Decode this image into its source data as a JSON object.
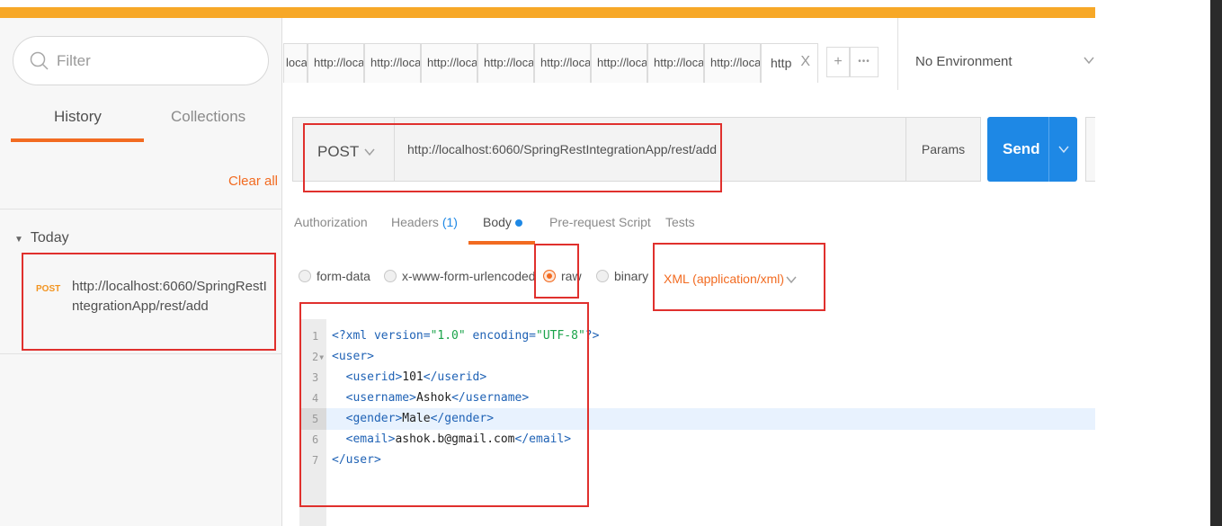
{
  "sidebar": {
    "filter_placeholder": "Filter",
    "tabs": {
      "history": "History",
      "collections": "Collections"
    },
    "clear_all": "Clear all",
    "group_label": "Today",
    "history_items": [
      {
        "method": "POST",
        "url": "http://localhost:6060/SpringRestIntegrationApp/rest/add"
      }
    ]
  },
  "tabs": {
    "items": [
      "loca",
      "http://loca",
      "http://loca",
      "http://loca",
      "http://loca",
      "http://loca",
      "http://loca",
      "http://loca",
      "http://loca"
    ],
    "active": "http",
    "close": "X",
    "add": "+",
    "more": "•••"
  },
  "environment": {
    "selected": "No Environment"
  },
  "request": {
    "method": "POST",
    "url": "http://localhost:6060/SpringRestIntegrationApp/rest/add",
    "params_label": "Params",
    "send_label": "Send"
  },
  "subtabs": {
    "authorization": "Authorization",
    "headers": "Headers",
    "headers_count": "(1)",
    "body": "Body",
    "prerequest": "Pre-request Script",
    "tests": "Tests"
  },
  "body_options": {
    "form_data": "form-data",
    "urlencoded": "x-www-form-urlencoded",
    "raw": "raw",
    "binary": "binary",
    "content_type": "XML (application/xml)",
    "selected": "raw"
  },
  "editor": {
    "line_numbers": [
      "1",
      "2",
      "3",
      "4",
      "5",
      "6",
      "7"
    ],
    "active_line": 5,
    "lines": {
      "l1": {
        "open": "<?xml version=",
        "v1": "\"1.0\"",
        "mid": " encoding=",
        "v2": "\"UTF-8\"",
        "close": "?>"
      },
      "l2": {
        "tag": "<user>"
      },
      "l3": {
        "open": "<userid>",
        "val": "101",
        "close": "</userid>"
      },
      "l4": {
        "open": "<username>",
        "val": "Ashok",
        "close": "</username>"
      },
      "l5": {
        "open": "<gender>",
        "val": "Male",
        "close": "</gender>"
      },
      "l6": {
        "open": "<email>",
        "val": "ashok.b@gmail.com",
        "close": "</email>"
      },
      "l7": {
        "tag": "</user>"
      }
    }
  },
  "colors": {
    "accent_orange": "#f26b21",
    "send_blue": "#1e88e5",
    "annotation_red": "#e0302d",
    "top_bar": "#f7a827"
  }
}
